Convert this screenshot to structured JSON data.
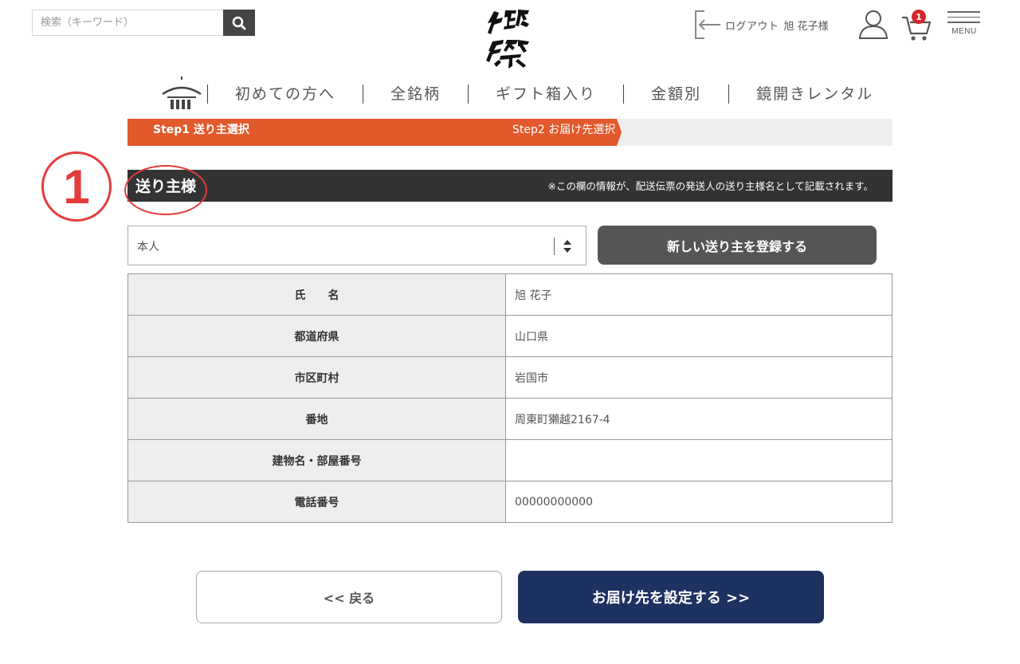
{
  "header": {
    "search": {
      "placeholder": "検索（キーワード）"
    },
    "logout_label": "ログアウト",
    "user_name": "旭 花子様",
    "cart_count": "1",
    "menu_label": "MENU"
  },
  "nav": {
    "items": [
      "初めての方へ",
      "全銘柄",
      "ギフト箱入り",
      "金額別",
      "鏡開きレンタル"
    ]
  },
  "steps": {
    "step1": "Step1 送り主選択",
    "step2": "Step2 お届け先選択"
  },
  "annotation": {
    "number": "1"
  },
  "section": {
    "title": "送り主様",
    "note": "※この欄の情報が、配送伝票の発送人の送り主様名として記載されます。"
  },
  "sender_select": {
    "value": "本人"
  },
  "register_button": "新しい送り主を登録する",
  "table": {
    "rows": [
      {
        "label": "氏　　名",
        "value": "旭 花子"
      },
      {
        "label": "都道府県",
        "value": "山口県"
      },
      {
        "label": "市区町村",
        "value": "岩国市"
      },
      {
        "label": "番地",
        "value": "周東町獺越2167-4"
      },
      {
        "label": "建物名・部屋番号",
        "value": ""
      },
      {
        "label": "電話番号",
        "value": "00000000000"
      }
    ]
  },
  "buttons": {
    "back": "<< 戻る",
    "next": "お届け先を設定する >>"
  },
  "colors": {
    "accent_orange": "#e2592c",
    "dark_header": "#333333",
    "navy": "#1e3262",
    "annotation_red": "#e43c3c"
  },
  "icons": {
    "search": "search-icon",
    "logout": "logout-icon",
    "user": "user-icon",
    "cart": "cart-icon",
    "menu": "hamburger-menu-icon",
    "home": "home-icon",
    "logo": "dassai-logo"
  }
}
